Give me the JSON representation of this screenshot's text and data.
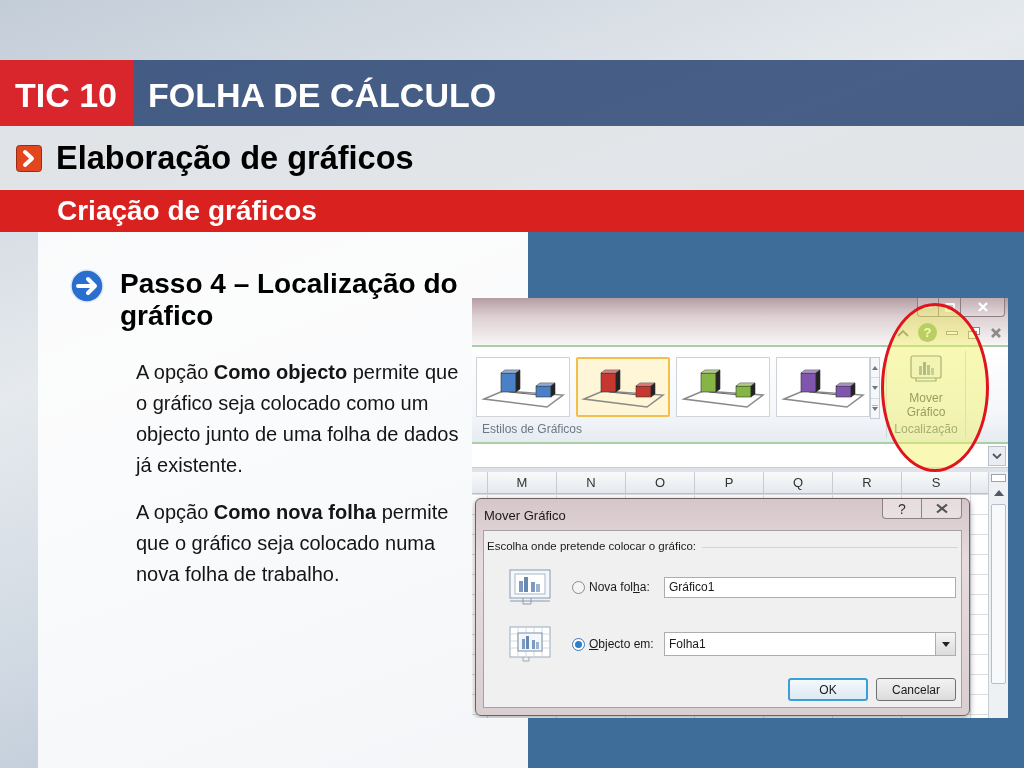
{
  "header": {
    "course": "TIC 10",
    "title": "FOLHA DE CÁLCULO"
  },
  "section": {
    "title": "Elaboração de gráficos"
  },
  "subsection": {
    "title": "Criação de gráficos"
  },
  "content": {
    "heading": "Passo 4 – Localização do gráfico",
    "paragraphs": [
      "A opção **Como objecto** permite que o gráfico seja colocado como um objecto junto de uma folha de dados já existente.",
      "A opção **Como nova folha** permite que o gráfico seja colocado numa nova folha de trabalho."
    ]
  },
  "screenshot": {
    "ribbon_help": "?",
    "chart_styles": [
      {
        "color": "#4a80c6",
        "selected": false
      },
      {
        "color": "#c6382f",
        "selected": true
      },
      {
        "color": "#86b545",
        "selected": false
      },
      {
        "color": "#8055ad",
        "selected": false
      }
    ],
    "styles_group": "Estilos de Gráficos",
    "move_chart_button": "Mover Gráfico",
    "location_group": "Localização",
    "columns": [
      "M",
      "N",
      "O",
      "P",
      "Q",
      "R",
      "S"
    ],
    "dialog": {
      "title": "Mover Gráfico",
      "help": "?",
      "prompt": "Escolha onde pretende colocar o gráfico:",
      "options": [
        {
          "kind": "new_sheet",
          "label_start": "Nova fol",
          "mnemonic": "h",
          "label_end": "a:",
          "selected": false,
          "value": "Gráfico1"
        },
        {
          "kind": "object",
          "mnemonic": "O",
          "label_end": "bjecto em:",
          "selected": true,
          "value": "Folha1"
        }
      ],
      "buttons": [
        {
          "label": "OK",
          "default": true
        },
        {
          "label": "Cancelar",
          "default": false
        }
      ]
    }
  }
}
